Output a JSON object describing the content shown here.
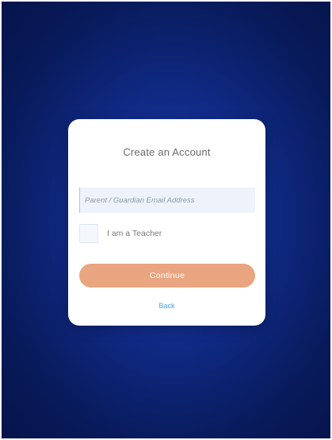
{
  "theme": {
    "background": "#0d2680",
    "card": "#ffffff",
    "accent": "#e8a57f",
    "link": "#4aa3e0"
  },
  "form": {
    "title": "Create an Account",
    "email_placeholder": "Parent / Guardian Email Address",
    "email_value": "",
    "teacher_checkbox_label": "I am a Teacher",
    "teacher_checked": false,
    "continue_label": "Continue",
    "back_label": "Back"
  }
}
